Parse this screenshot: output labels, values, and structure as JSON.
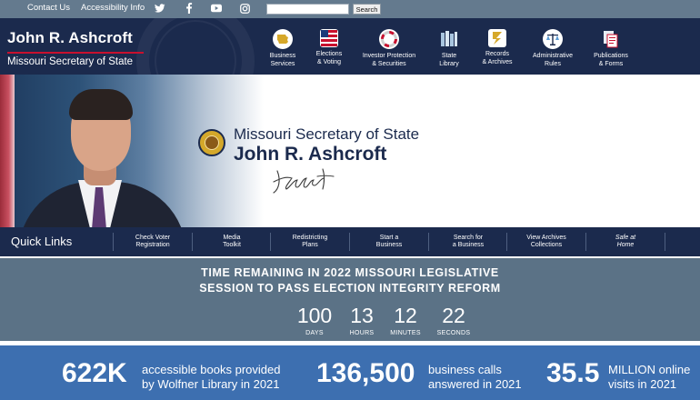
{
  "topbar": {
    "contact": "Contact Us",
    "accessibility": "Accessibility Info",
    "search_placeholder": "",
    "search_button": "Search",
    "social": [
      "twitter-icon",
      "facebook-icon",
      "youtube-icon",
      "instagram-icon"
    ]
  },
  "brand": {
    "name": "John R. Ashcroft",
    "subtitle": "Missouri Secretary of State"
  },
  "nav": [
    {
      "label": "Business\nServices",
      "icon": "missouri-map-icon"
    },
    {
      "label": "Elections\n& Voting",
      "icon": "flag-icon"
    },
    {
      "label": "Investor Protection\n& Securities",
      "icon": "lifebuoy-icon"
    },
    {
      "label": "State\nLibrary",
      "icon": "books-icon"
    },
    {
      "label": "Records\n& Archives",
      "icon": "lightning-record-icon"
    },
    {
      "label": "Administrative\nRules",
      "icon": "scales-icon"
    },
    {
      "label": "Publications\n& Forms",
      "icon": "documents-icon"
    }
  ],
  "hero": {
    "title": "Missouri Secretary of State",
    "name": "John R. Ashcroft"
  },
  "quick_links": {
    "title": "Quick Links",
    "items": [
      "Check Voter\nRegistration",
      "Media\nToolkit",
      "Redistricting\nPlans",
      "Start a\nBusiness",
      "Search for\na Business",
      "View Archives\nCollections",
      "Safe at\nHome"
    ]
  },
  "countdown": {
    "title": "TIME REMAINING IN 2022 MISSOURI LEGISLATIVE\nSESSION TO PASS ELECTION INTEGRITY REFORM",
    "units": [
      {
        "value": "100",
        "label": "DAYS"
      },
      {
        "value": "13",
        "label": "HOURS"
      },
      {
        "value": "12",
        "label": "MINUTES"
      },
      {
        "value": "22",
        "label": "SECONDS"
      }
    ]
  },
  "stats": [
    {
      "number": "622K",
      "text": "accessible books provided\nby Wolfner Library in 2021"
    },
    {
      "number": "136,500",
      "text": "business calls\nanswered in 2021"
    },
    {
      "number": "35.5",
      "text": "MILLION online\nvisits in 2021"
    }
  ],
  "colors": {
    "navy": "#1b2a4d",
    "slate": "#647a8e",
    "countdown": "#5b7286",
    "stats_blue": "#3d6fb0",
    "accent_red": "#c8102e"
  }
}
